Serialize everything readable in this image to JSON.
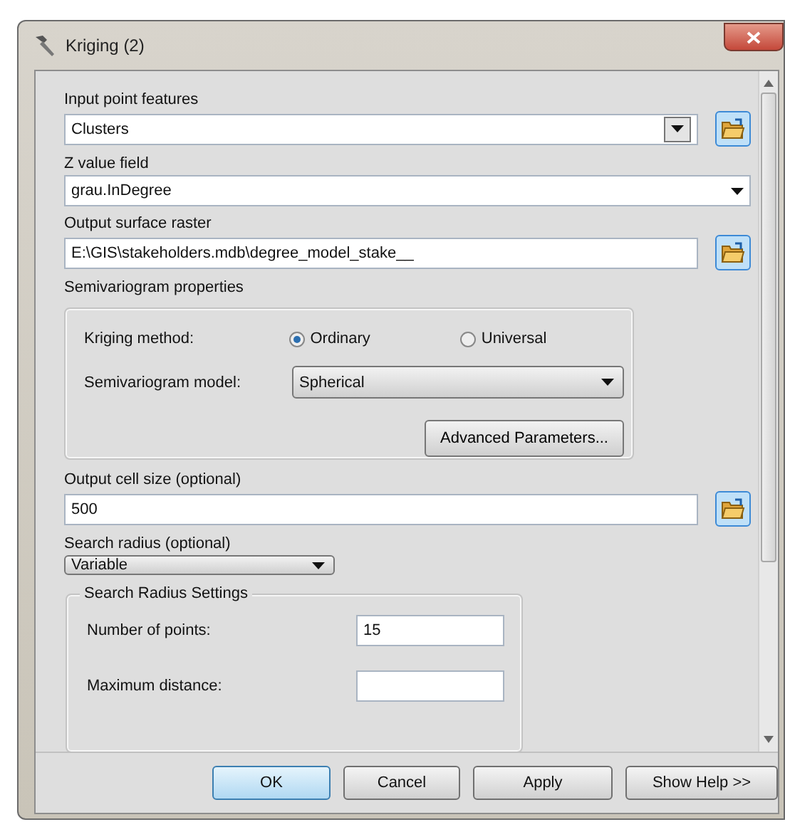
{
  "window": {
    "title": "Kriging (2)"
  },
  "parameters": [
    {
      "kind": "combo",
      "label": "Input point features",
      "value": "Clusters",
      "browse": true
    },
    {
      "kind": "combo",
      "label": "Z value field",
      "value": "grau.InDegree",
      "browse": false
    },
    {
      "kind": "text",
      "label": "Output surface raster",
      "value": "E:\\GIS\\stakeholders.mdb\\degree_model_stake__",
      "browse": true
    },
    {
      "kind": "semivariogram",
      "label": "Semivariogram properties",
      "method_label": "Kriging method:",
      "methods": [
        {
          "label": "Ordinary",
          "selected": true
        },
        {
          "label": "Universal",
          "selected": false
        }
      ],
      "model_label": "Semivariogram model:",
      "model": "Spherical",
      "advanced_button": "Advanced Parameters..."
    },
    {
      "kind": "text",
      "label": "Output cell size (optional)",
      "value": "500",
      "browse": true
    },
    {
      "kind": "select",
      "label": "Search radius (optional)",
      "value": "Variable"
    },
    {
      "kind": "radius_settings",
      "legend": "Search Radius Settings",
      "rows": [
        {
          "label": "Number of points:",
          "value": "15"
        },
        {
          "label": "Maximum distance:",
          "value": ""
        }
      ]
    }
  ],
  "buttons": [
    {
      "label": "OK",
      "default": true
    },
    {
      "label": "Cancel",
      "default": false
    },
    {
      "label": "Apply",
      "default": false
    },
    {
      "label": "Show Help >>",
      "default": false
    }
  ]
}
